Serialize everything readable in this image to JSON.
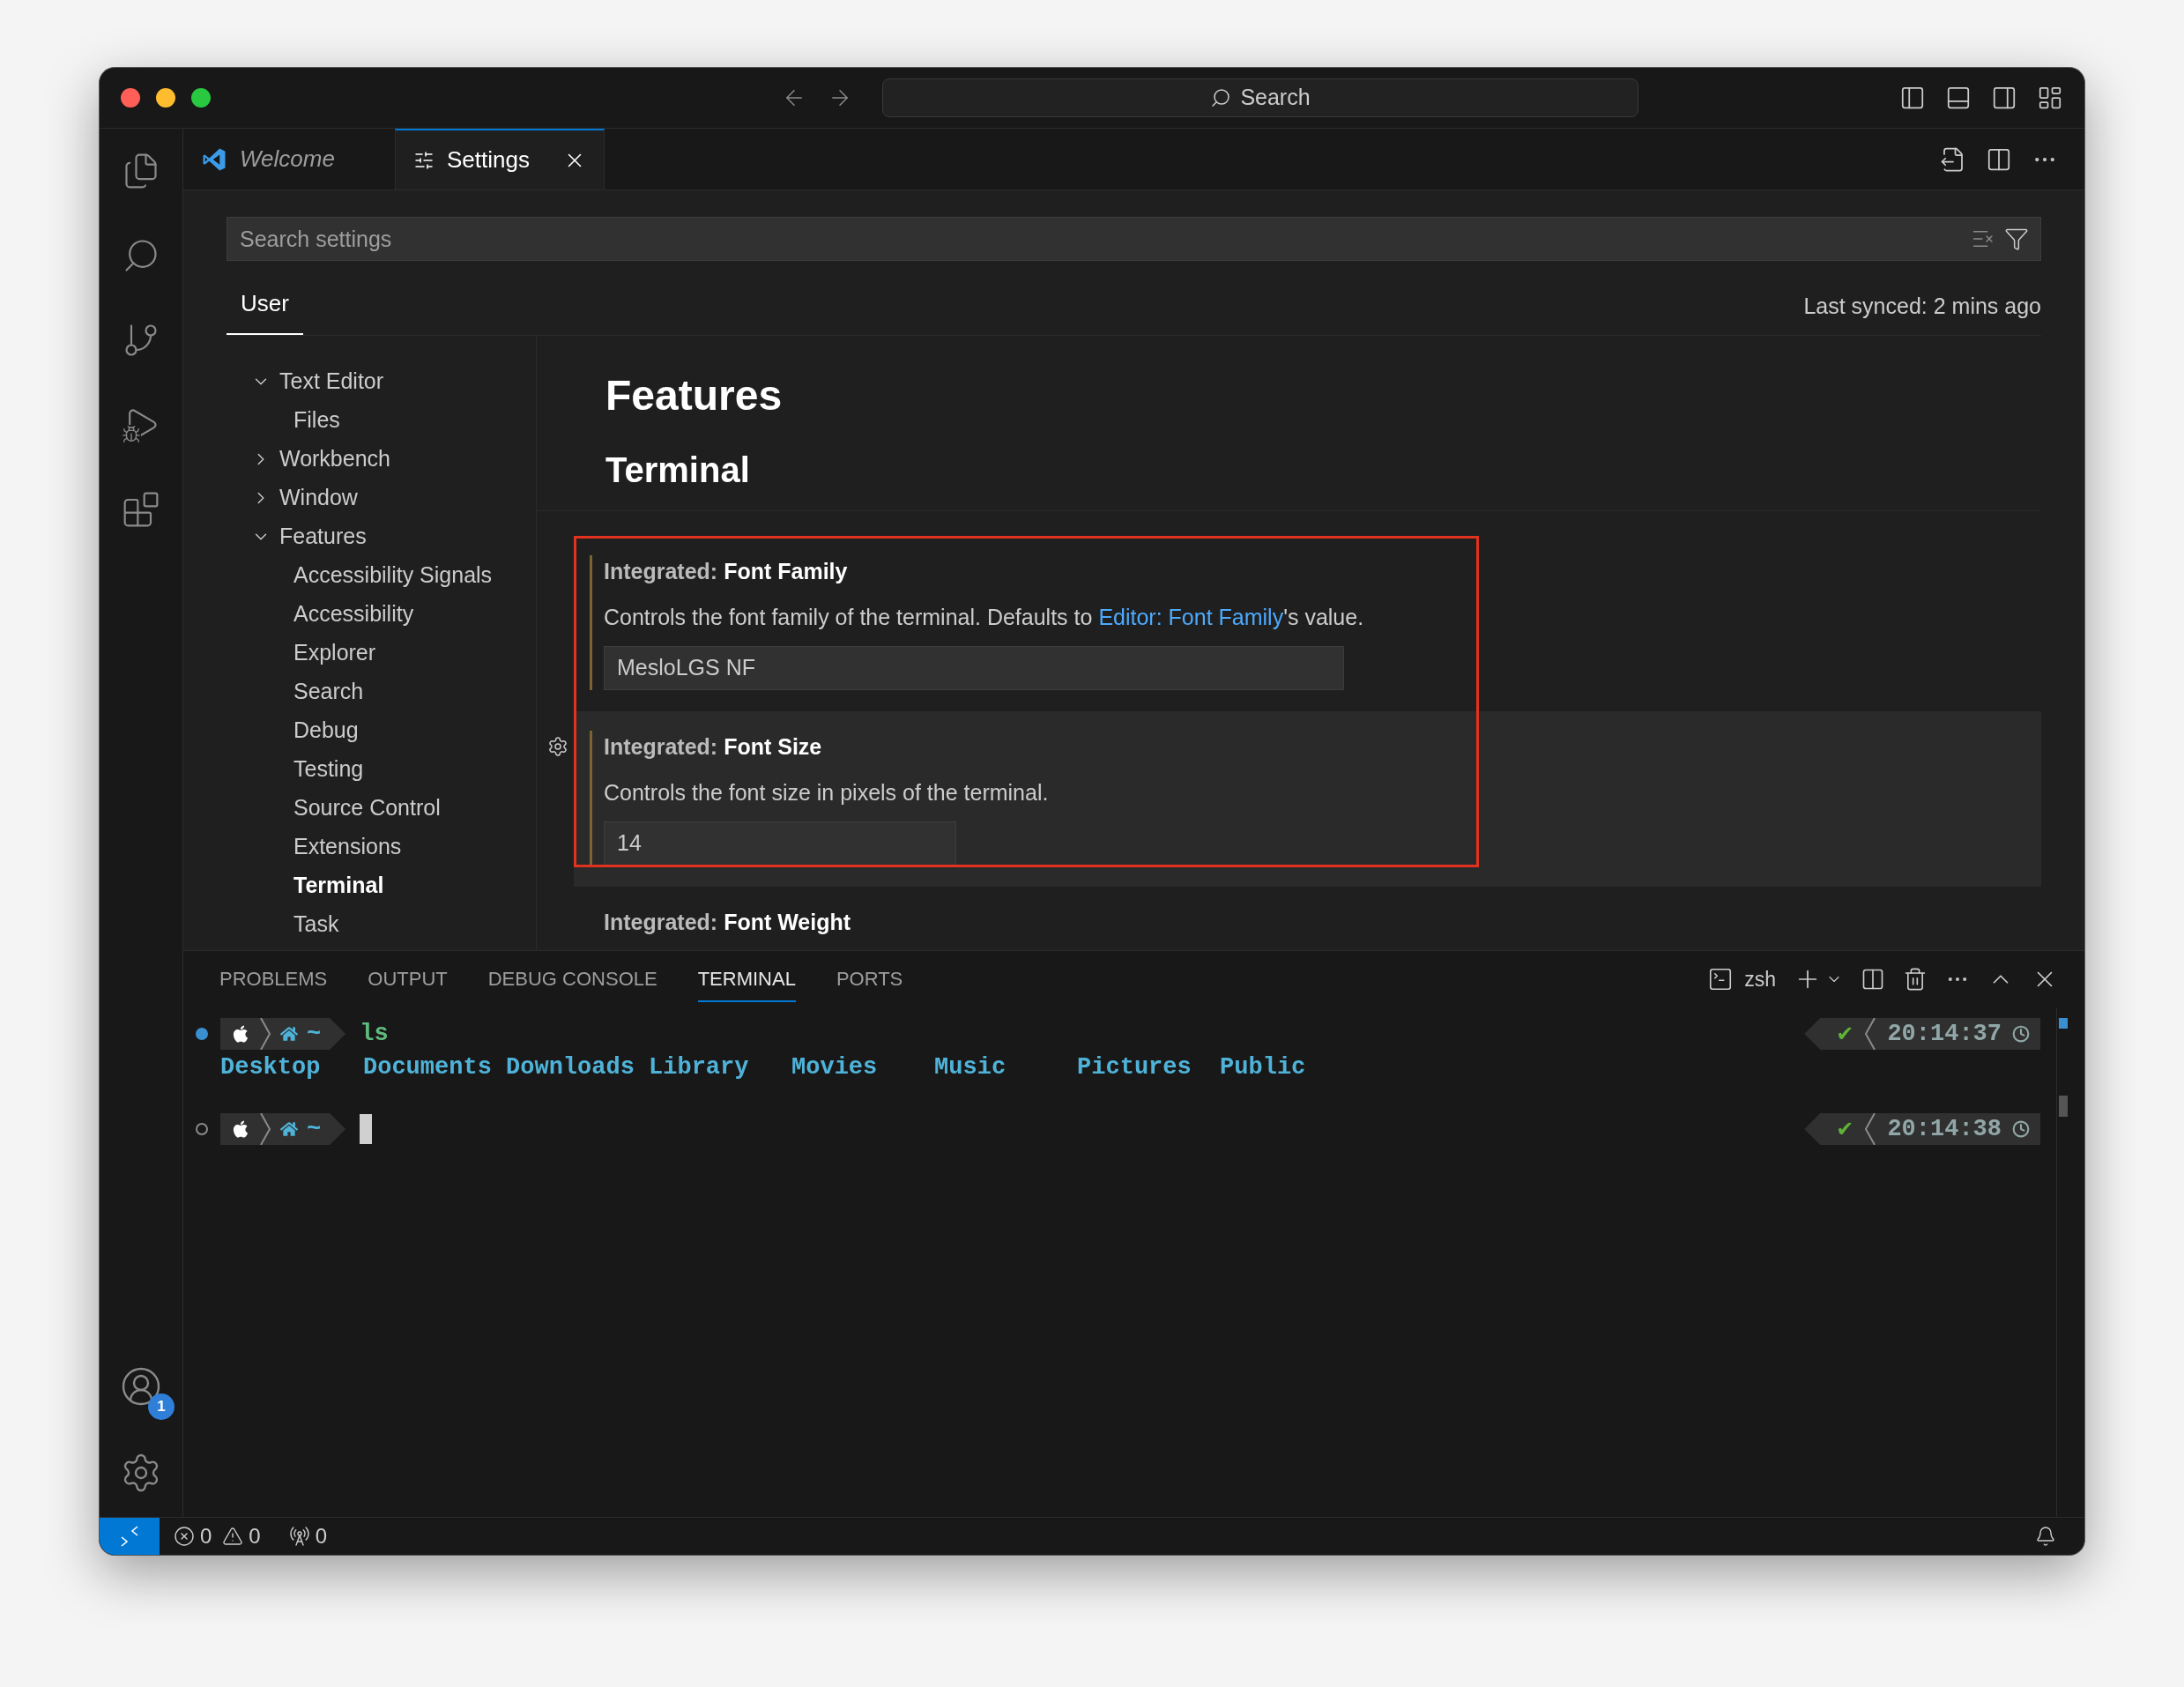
{
  "title_bar": {
    "search": "Search"
  },
  "activity_bar": {
    "accounts_badge": "1"
  },
  "tabs": [
    {
      "label": "Welcome",
      "kind": "welcome",
      "preview": true,
      "selected": false
    },
    {
      "label": "Settings",
      "kind": "settings",
      "preview": false,
      "selected": true
    }
  ],
  "settings": {
    "search": {
      "placeholder": "Search settings"
    },
    "scopes": [
      {
        "label": "User",
        "selected": true
      }
    ],
    "last_synced": "Last synced: 2 mins ago",
    "toc": [
      {
        "label": "Text Editor",
        "expanded": true,
        "selected": false,
        "children": [
          {
            "label": "Files",
            "selected": false
          }
        ]
      },
      {
        "label": "Workbench",
        "expanded": false,
        "selected": false
      },
      {
        "label": "Window",
        "expanded": false,
        "selected": false
      },
      {
        "label": "Features",
        "expanded": true,
        "selected": false,
        "children": [
          {
            "label": "Accessibility Signals",
            "selected": false
          },
          {
            "label": "Accessibility",
            "selected": false
          },
          {
            "label": "Explorer",
            "selected": false
          },
          {
            "label": "Search",
            "selected": false
          },
          {
            "label": "Debug",
            "selected": false
          },
          {
            "label": "Testing",
            "selected": false
          },
          {
            "label": "Source Control",
            "selected": false
          },
          {
            "label": "Extensions",
            "selected": false
          },
          {
            "label": "Terminal",
            "selected": true
          },
          {
            "label": "Task",
            "selected": false
          }
        ]
      }
    ],
    "headings": [
      "Features",
      "Terminal"
    ],
    "items": [
      {
        "category": "Integrated:",
        "title": "Font Family",
        "description": "Controls the font family of the terminal. Defaults to ",
        "link": "Editor: Font Family",
        "description_end": "'s value.",
        "value": "MesloLGS NF",
        "modified": true,
        "focused": false,
        "highlighted": true
      },
      {
        "category": "Integrated:",
        "title": "Font Size",
        "description": "Controls the font size in pixels of the terminal.",
        "value": "14",
        "modified": true,
        "focused": true,
        "highlighted": true
      },
      {
        "category": "Integrated:",
        "title": "Font Weight",
        "modified": false,
        "focused": false,
        "highlighted": false
      }
    ]
  },
  "panel": {
    "tabs": [
      {
        "label": "PROBLEMS",
        "selected": false
      },
      {
        "label": "OUTPUT",
        "selected": false
      },
      {
        "label": "DEBUG CONSOLE",
        "selected": false
      },
      {
        "label": "TERMINAL",
        "selected": true
      },
      {
        "label": "PORTS",
        "selected": false
      }
    ],
    "terminal_name": "zsh",
    "lines": [
      {
        "kind": "prompt",
        "ran": true,
        "dir": "~",
        "command": "ls",
        "cursor": false,
        "check": "✔",
        "time": "20:14:37"
      },
      {
        "kind": "output",
        "entries": [
          "Desktop",
          "Documents",
          "Downloads",
          "Library",
          "Movies",
          "Music",
          "Pictures",
          "Public"
        ]
      },
      {
        "kind": "prompt",
        "ran": false,
        "dir": "~",
        "cursor": true,
        "check": "✔",
        "time": "20:14:38"
      }
    ]
  },
  "status_bar": {
    "errors": "0",
    "warnings": "0",
    "ports": "0"
  }
}
